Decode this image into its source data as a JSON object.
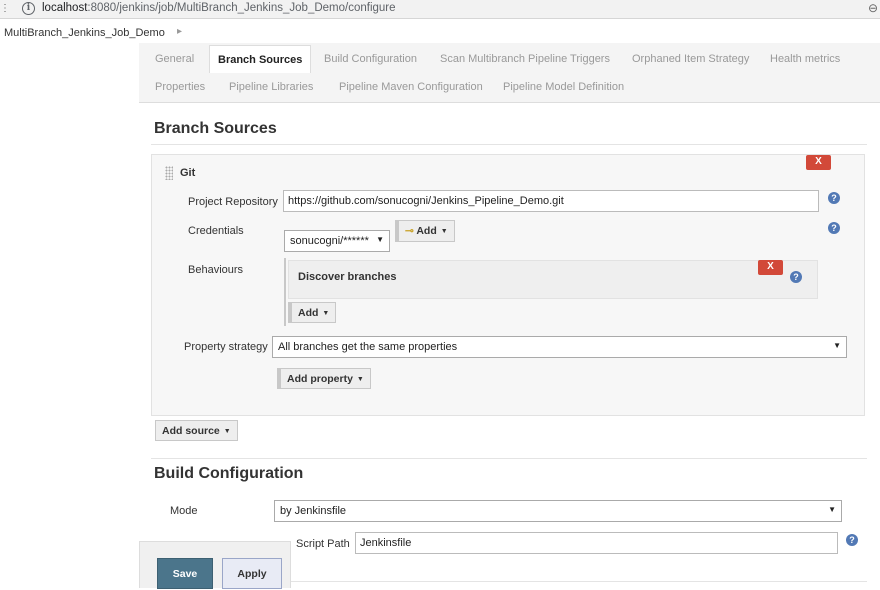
{
  "browser": {
    "url_host": "localhost",
    "url_path": ":8080/jenkins/job/MultiBranch_Jenkins_Job_Demo/configure"
  },
  "breadcrumb": {
    "item": "MultiBranch_Jenkins_Job_Demo",
    "separator": "▸"
  },
  "tabs": {
    "row1": [
      "General",
      "Branch Sources",
      "Build Configuration",
      "Scan Multibranch Pipeline Triggers",
      "Orphaned Item Strategy",
      "Health metrics"
    ],
    "row2": [
      "Properties",
      "Pipeline Libraries",
      "Pipeline Maven Configuration",
      "Pipeline Model Definition"
    ],
    "active": "Branch Sources"
  },
  "branch_sources": {
    "title": "Branch Sources",
    "git": {
      "title": "Git",
      "delete_label": "X",
      "project_repository_label": "Project Repository",
      "project_repository_value": "https://github.com/sonucogni/Jenkins_Pipeline_Demo.git",
      "credentials_label": "Credentials",
      "credentials_value": "sonucogni/******",
      "credentials_add_label": "Add",
      "behaviours_label": "Behaviours",
      "discover_branches_label": "Discover branches",
      "behaviours_add_label": "Add",
      "property_strategy_label": "Property strategy",
      "property_strategy_value": "All branches get the same properties",
      "add_property_label": "Add property"
    },
    "add_source_label": "Add source"
  },
  "build_configuration": {
    "title": "Build Configuration",
    "mode_label": "Mode",
    "mode_value": "by Jenkinsfile",
    "script_path_label": "Script Path",
    "script_path_value": "Jenkinsfile"
  },
  "footer": {
    "save_label": "Save",
    "apply_label": "Apply"
  },
  "icons": {
    "help": "?",
    "dropdown_arrow": "▼",
    "key": "key-icon"
  },
  "colors": {
    "save_bg": "#4b758b",
    "delete_bg": "#d24939",
    "help_bg": "#5279b5"
  }
}
